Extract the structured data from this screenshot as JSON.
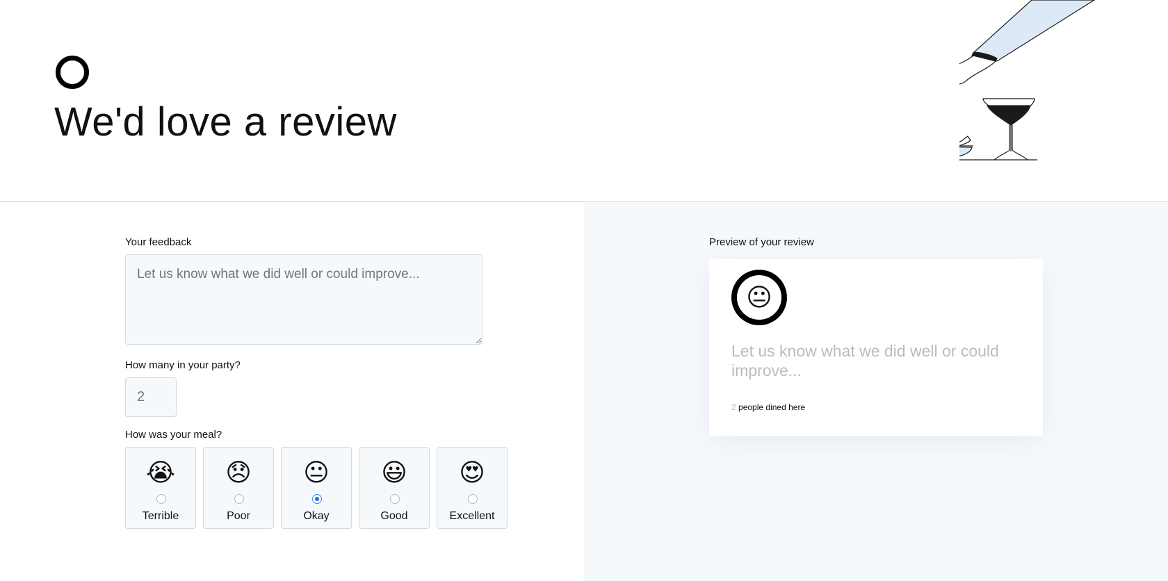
{
  "header": {
    "title": "We'd love a review"
  },
  "form": {
    "feedback_label": "Your feedback",
    "feedback_placeholder": "Let us know what we did well or could improve...",
    "party_label": "How many in your party?",
    "party_placeholder": "2",
    "meal_label": "How was your meal?",
    "ratings": [
      {
        "emoji": "😭",
        "label": "Terrible",
        "checked": false
      },
      {
        "emoji": "😞",
        "label": "Poor",
        "checked": false
      },
      {
        "emoji": "😐",
        "label": "Okay",
        "checked": true
      },
      {
        "emoji": "😃",
        "label": "Good",
        "checked": false
      },
      {
        "emoji": "😍",
        "label": "Excellent",
        "checked": false
      }
    ]
  },
  "preview": {
    "label": "Preview of your review",
    "emoji": "😐",
    "text": "Let us know what we did well or could improve...",
    "party_count": "2",
    "footer_suffix": "people dined here"
  },
  "colors": {
    "accent": "#1d6fe8",
    "pane_bg": "#f6f9fc",
    "illustration_sleeve": "#dde9f6"
  },
  "icons": [
    "logo-ring-icon",
    "dining-illustration-icon"
  ]
}
